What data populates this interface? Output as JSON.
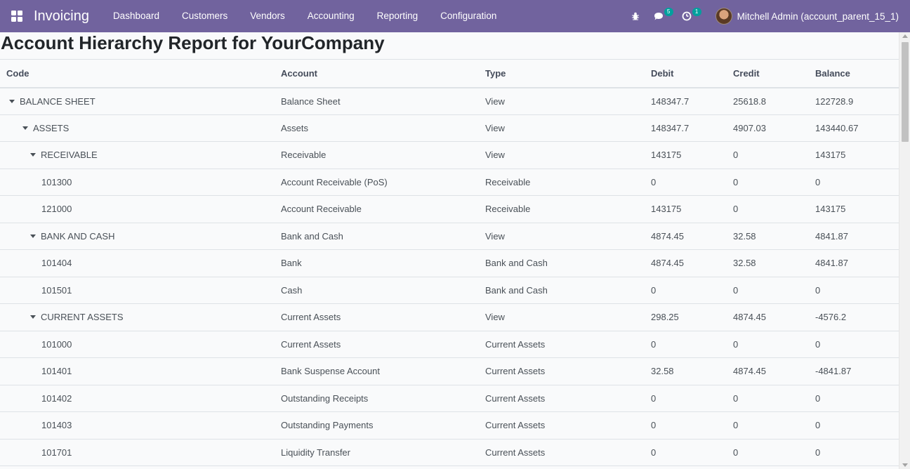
{
  "navbar": {
    "app_name": "Invoicing",
    "menu": [
      "Dashboard",
      "Customers",
      "Vendors",
      "Accounting",
      "Reporting",
      "Configuration"
    ],
    "messages_count": "5",
    "activities_count": "1",
    "user_name": "Mitchell Admin (account_parent_15_1)",
    "accent_color": "#71639e"
  },
  "report": {
    "title": "Account Hierarchy Report for YourCompany",
    "columns": {
      "code": "Code",
      "account": "Account",
      "type": "Type",
      "debit": "Debit",
      "credit": "Credit",
      "balance": "Balance"
    },
    "rows": [
      {
        "code": "BALANCE SHEET",
        "account": "Balance Sheet",
        "type": "View",
        "debit": "148347.7",
        "credit": "25618.8",
        "balance": "122728.9"
      },
      {
        "code": "ASSETS",
        "account": "Assets",
        "type": "View",
        "debit": "148347.7",
        "credit": "4907.03",
        "balance": "143440.67"
      },
      {
        "code": "RECEIVABLE",
        "account": "Receivable",
        "type": "View",
        "debit": "143175",
        "credit": "0",
        "balance": "143175"
      },
      {
        "code": "101300",
        "account": "Account Receivable (PoS)",
        "type": "Receivable",
        "debit": "0",
        "credit": "0",
        "balance": "0"
      },
      {
        "code": "121000",
        "account": "Account Receivable",
        "type": "Receivable",
        "debit": "143175",
        "credit": "0",
        "balance": "143175"
      },
      {
        "code": "BANK AND CASH",
        "account": "Bank and Cash",
        "type": "View",
        "debit": "4874.45",
        "credit": "32.58",
        "balance": "4841.87"
      },
      {
        "code": "101404",
        "account": "Bank",
        "type": "Bank and Cash",
        "debit": "4874.45",
        "credit": "32.58",
        "balance": "4841.87"
      },
      {
        "code": "101501",
        "account": "Cash",
        "type": "Bank and Cash",
        "debit": "0",
        "credit": "0",
        "balance": "0"
      },
      {
        "code": "CURRENT ASSETS",
        "account": "Current Assets",
        "type": "View",
        "debit": "298.25",
        "credit": "4874.45",
        "balance": "-4576.2"
      },
      {
        "code": "101000",
        "account": "Current Assets",
        "type": "Current Assets",
        "debit": "0",
        "credit": "0",
        "balance": "0"
      },
      {
        "code": "101401",
        "account": "Bank Suspense Account",
        "type": "Current Assets",
        "debit": "32.58",
        "credit": "4874.45",
        "balance": "-4841.87"
      },
      {
        "code": "101402",
        "account": "Outstanding Receipts",
        "type": "Current Assets",
        "debit": "0",
        "credit": "0",
        "balance": "0"
      },
      {
        "code": "101403",
        "account": "Outstanding Payments",
        "type": "Current Assets",
        "debit": "0",
        "credit": "0",
        "balance": "0"
      },
      {
        "code": "101701",
        "account": "Liquidity Transfer",
        "type": "Current Assets",
        "debit": "0",
        "credit": "0",
        "balance": "0"
      }
    ]
  }
}
